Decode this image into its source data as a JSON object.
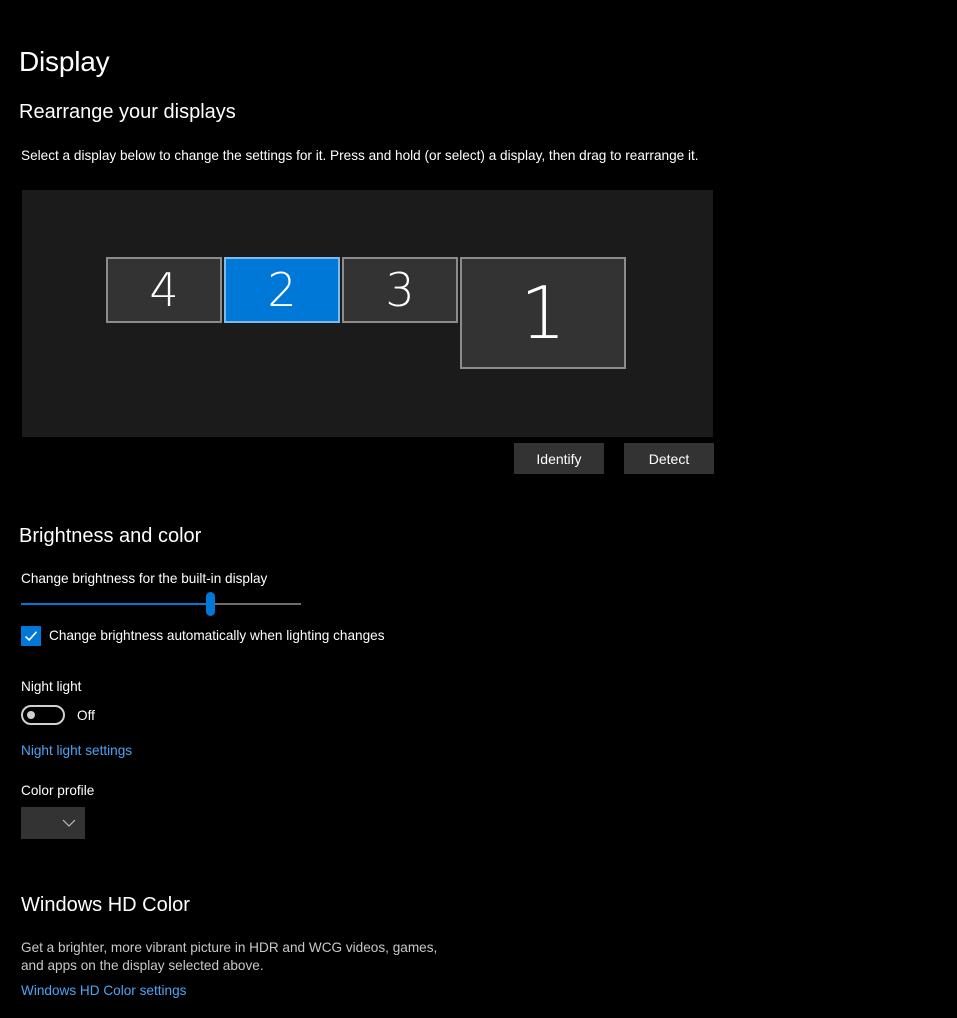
{
  "page": {
    "title": "Display"
  },
  "rearrange": {
    "heading": "Rearrange your displays",
    "description": "Select a display below to change the settings for it. Press and hold (or select) a display, then drag to rearrange it.",
    "monitors": [
      {
        "label": "4",
        "selected": false
      },
      {
        "label": "2",
        "selected": true
      },
      {
        "label": "3",
        "selected": false
      },
      {
        "label": "1",
        "selected": false
      }
    ],
    "identify_label": "Identify",
    "detect_label": "Detect"
  },
  "brightness": {
    "heading": "Brightness and color",
    "slider_label": "Change brightness for the built-in display",
    "slider_value_fraction": 0.68,
    "auto_checkbox_label": "Change brightness automatically when lighting changes",
    "auto_checked": true,
    "night_light_label": "Night light",
    "night_light_state": "Off",
    "night_light_settings_link": "Night light settings",
    "color_profile_label": "Color profile",
    "color_profile_value": ""
  },
  "hdr": {
    "heading": "Windows HD Color",
    "description_line1": "Get a brighter, more vibrant picture in HDR and WCG videos, games,",
    "description_line2": "and apps on the display selected above.",
    "settings_link": "Windows HD Color settings"
  },
  "colors": {
    "accent": "#0078d7",
    "link": "#4ea3f5",
    "background": "#000000",
    "panel": "#1b1b1b",
    "control": "#333333"
  },
  "icons": {
    "checkbox": "checkmark-icon",
    "dropdown": "chevron-down-icon"
  }
}
